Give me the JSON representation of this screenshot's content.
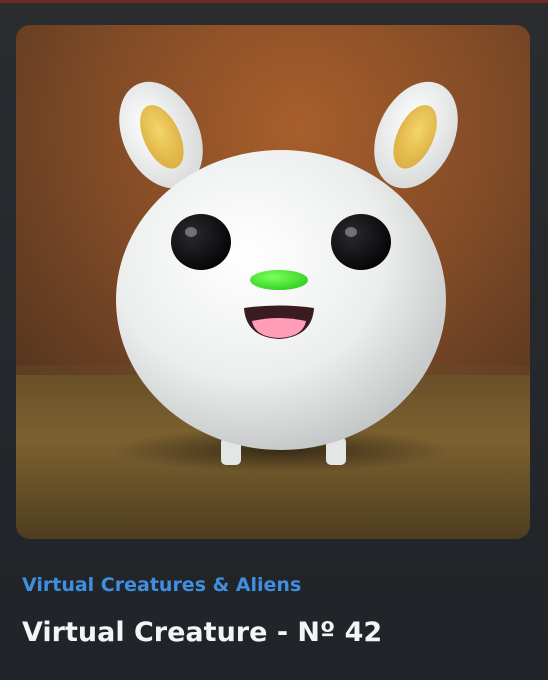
{
  "nft_card": {
    "category": "Virtual Creatures & Aliens",
    "title": "Virtual Creature - Nº 42",
    "image_icon": "creature-artwork"
  },
  "colors": {
    "background": "#23262b",
    "category_link": "#3f8fe0",
    "title_text": "#f3f4f6",
    "accent_strip": "#6e2a1e"
  }
}
